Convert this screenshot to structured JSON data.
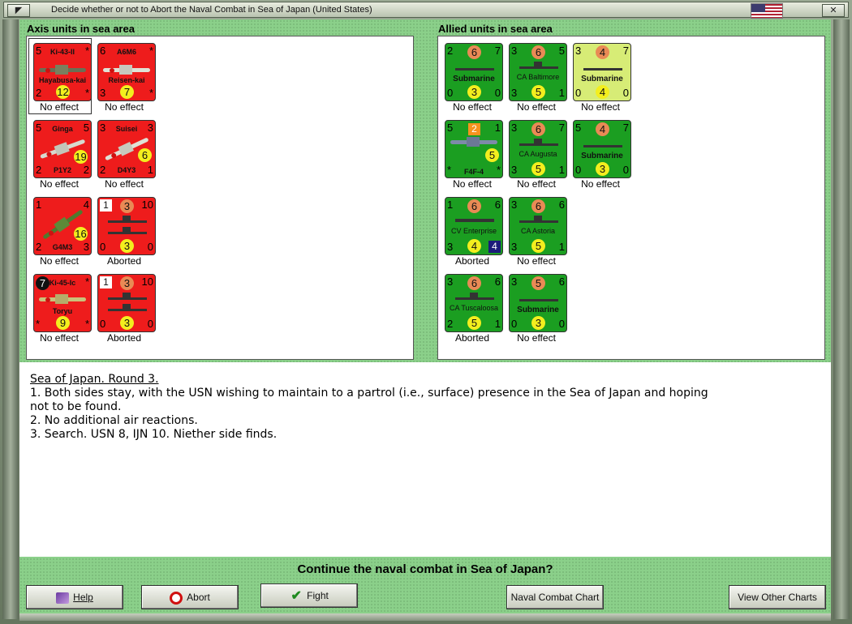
{
  "window": {
    "title": "Decide whether or not to Abort the Naval Combat in Sea of Japan (United States)",
    "close_glyph": "✕"
  },
  "axis": {
    "header": "Axis units in sea area",
    "units": [
      {
        "tl": "5",
        "tr": "*",
        "name": "Ki-43-II",
        "sub": "Hayabusa-kai",
        "bl": "2",
        "br": "*",
        "circle": "12",
        "status": "No effect"
      },
      {
        "tl": "6",
        "tr": "*",
        "name": "A6M6",
        "sub": "Reisen-kai",
        "bl": "3",
        "br": "*",
        "circle": "7",
        "status": "No effect"
      },
      {
        "tl": "5",
        "tr": "5",
        "name": "Ginga",
        "sub": "P1Y2",
        "bl": "2",
        "br": "2",
        "circle": "19",
        "status": "No effect"
      },
      {
        "tl": "3",
        "tr": "3",
        "name": "Suisei",
        "sub": "D4Y3",
        "bl": "2",
        "br": "1",
        "circle": "6",
        "status": "No effect"
      },
      {
        "tl": "1",
        "tr": "4",
        "name": "",
        "sub": "G4M3",
        "bl": "2",
        "br": "3",
        "circle": "16",
        "status": "No effect"
      },
      {
        "tl": "1",
        "top": "3",
        "tr": "10",
        "name": "",
        "sub": "",
        "bl": "0",
        "bc": "3",
        "br": "0",
        "status": "Aborted"
      },
      {
        "tl": "7",
        "tr": "*",
        "name": "Ki-45-Ic",
        "sub": "Toryu",
        "bl": "*",
        "br": "*",
        "circle": "9",
        "status": "No effect"
      },
      {
        "tl": "1",
        "top": "3",
        "tr": "10",
        "name": "",
        "sub": "",
        "bl": "0",
        "bc": "3",
        "br": "0",
        "status": "Aborted"
      }
    ]
  },
  "allied": {
    "header": "Allied units in sea area",
    "units": [
      {
        "tl": "2",
        "top": "6",
        "tr": "7",
        "name": "Submarine",
        "bl": "0",
        "bc": "3",
        "br": "0",
        "status": "No effect"
      },
      {
        "tl": "3",
        "top": "6",
        "tr": "5",
        "name": "CA Baltimore",
        "bl": "3",
        "bc": "5",
        "br": "1",
        "status": "No effect"
      },
      {
        "tl": "3",
        "top": "4",
        "tr": "7",
        "name": "Submarine",
        "bl": "0",
        "bc": "4",
        "br": "0",
        "status": "No effect"
      },
      {
        "tl": "5",
        "top": "2",
        "tr": "1",
        "name": "F4F-4",
        "bl": "*",
        "bc": "5",
        "br": "*",
        "status": "No effect"
      },
      {
        "tl": "3",
        "top": "6",
        "tr": "7",
        "name": "CA Augusta",
        "bl": "3",
        "bc": "5",
        "br": "1",
        "status": "No effect"
      },
      {
        "tl": "5",
        "top": "4",
        "tr": "7",
        "name": "Submarine",
        "bl": "0",
        "bc": "3",
        "br": "0",
        "status": "No effect"
      },
      {
        "tl": "1",
        "top": "6",
        "tr": "6",
        "name": "CV Enterprise",
        "bl": "3",
        "bc": "4",
        "br": "4",
        "status": "Aborted"
      },
      {
        "tl": "3",
        "top": "6",
        "tr": "6",
        "name": "CA Astoria",
        "bl": "3",
        "bc": "5",
        "br": "1",
        "status": "No effect"
      },
      {
        "tl": "3",
        "top": "6",
        "tr": "6",
        "name": "CA Tuscaloosa",
        "bl": "2",
        "bc": "5",
        "br": "1",
        "status": "Aborted"
      },
      {
        "tl": "3",
        "top": "5",
        "tr": "6",
        "name": "Submarine",
        "bl": "0",
        "bc": "3",
        "br": "0",
        "status": "No effect"
      }
    ]
  },
  "notes": {
    "heading": "Sea of Japan.  Round 3.",
    "line1": "1.  Both sides stay, with the USN wishing to maintain to a partrol (i.e., surface) presence in the Sea of Japan and hoping",
    "line1b": "not to be found.",
    "line2": "2.  No additional air reactions.",
    "line3": "3. Search. USN 8, IJN 10.  Niether side finds."
  },
  "question": "Continue the naval combat in Sea of Japan?",
  "buttons": {
    "help": "Help",
    "abort": "Abort",
    "fight": "Fight",
    "naval_chart": "Naval Combat Chart",
    "other_charts": "View Other Charts"
  }
}
